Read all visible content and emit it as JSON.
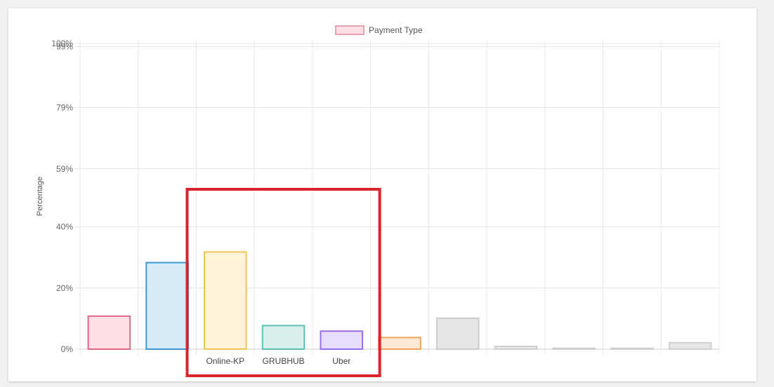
{
  "chart_data": {
    "type": "bar",
    "legend": {
      "label": "Payment Type",
      "position": "top-center",
      "color": "#e8a1b0"
    },
    "ylabel": "Percentage",
    "xlabel": "",
    "ylim": [
      0,
      100
    ],
    "y_ticks": [
      "0%",
      "20%",
      "40%",
      "59%",
      "79%",
      "99%",
      "100%"
    ],
    "y_tick_values": [
      0,
      20,
      40,
      59,
      79,
      99,
      100
    ],
    "grid": true,
    "categories": [
      "",
      "",
      "Online-KP",
      "GRUBHUB",
      "Uber",
      "",
      "",
      "",
      "",
      "",
      ""
    ],
    "values": [
      10.8,
      28.3,
      31.8,
      7.7,
      5.9,
      3.8,
      10.1,
      0.9,
      0.3,
      0.3,
      2.1
    ],
    "colors": [
      {
        "fill": "#ffe0e6",
        "stroke": "#e06a86"
      },
      {
        "fill": "#d6eaf8",
        "stroke": "#3c9bd6"
      },
      {
        "fill": "#fff3da",
        "stroke": "#f2c45a"
      },
      {
        "fill": "#d7f0ec",
        "stroke": "#5cc3b4"
      },
      {
        "fill": "#e6ddfb",
        "stroke": "#9a6cf0"
      },
      {
        "fill": "#fde9d6",
        "stroke": "#f2a35a"
      },
      {
        "fill": "#e6e6e6",
        "stroke": "#cccccc"
      },
      {
        "fill": "#e8e8e8",
        "stroke": "#cfcfcf"
      },
      {
        "fill": "#e8e8e8",
        "stroke": "#cfcfcf"
      },
      {
        "fill": "#e8e8e8",
        "stroke": "#cfcfcf"
      },
      {
        "fill": "#e6e6e6",
        "stroke": "#d0d0d0"
      }
    ],
    "highlight": {
      "categories": [
        "Online-KP",
        "GRUBHUB",
        "Uber"
      ],
      "color": "#d9232d"
    }
  }
}
